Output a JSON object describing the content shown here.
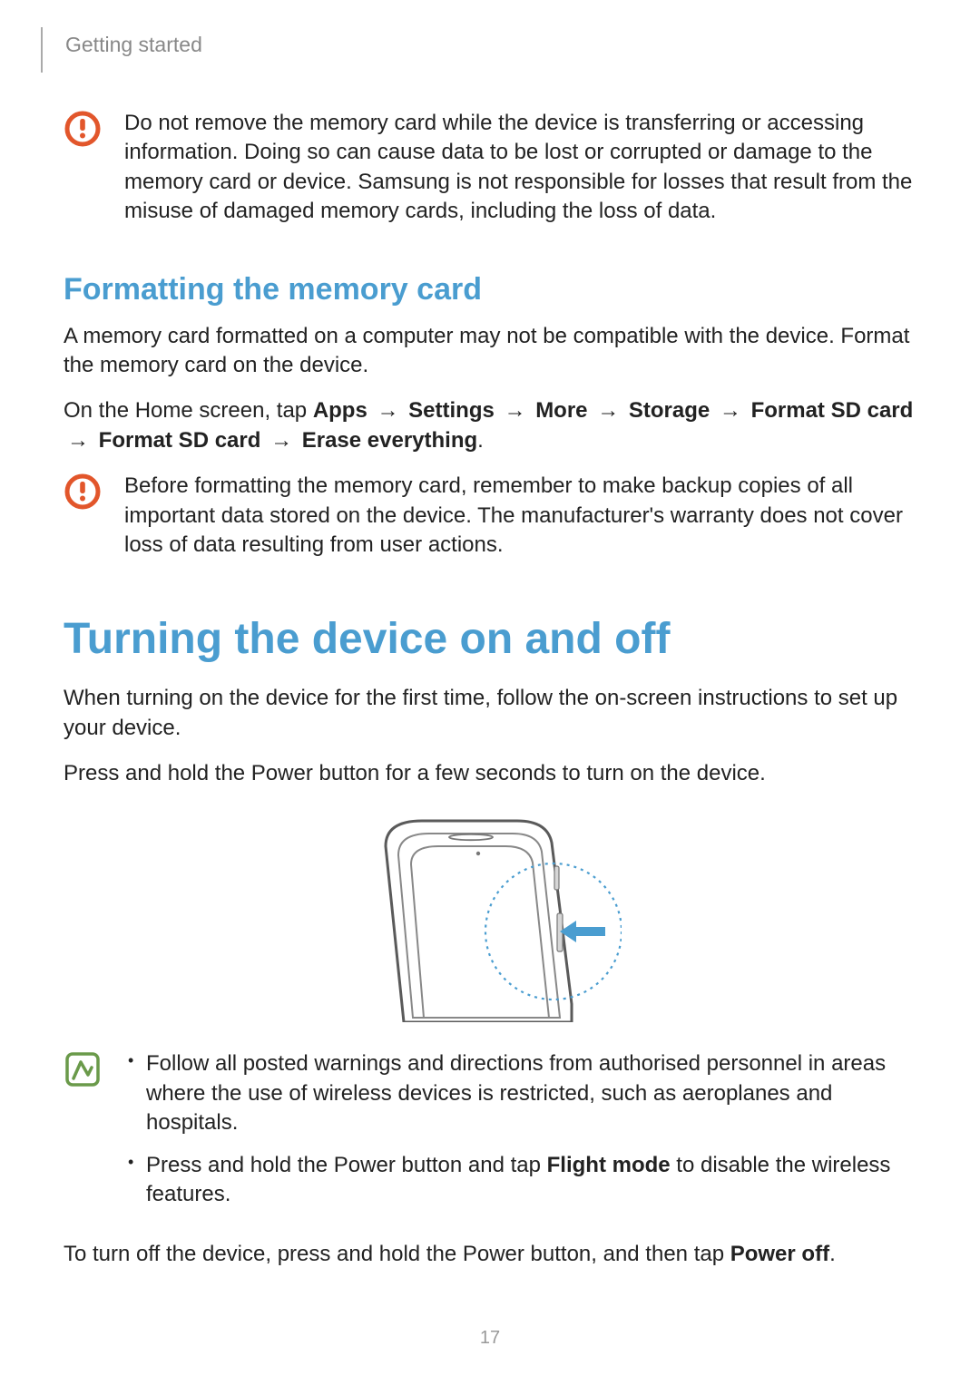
{
  "header": {
    "section": "Getting started"
  },
  "caution1": {
    "text": "Do not remove the memory card while the device is transferring or accessing information. Doing so can cause data to be lost or corrupted or damage to the memory card or device. Samsung is not responsible for losses that result from the misuse of damaged memory cards, including the loss of data."
  },
  "formatting": {
    "heading": "Formatting the memory card",
    "p1": "A memory card formatted on a computer may not be compatible with the device. Format the memory card on the device.",
    "p2_prefix": "On the Home screen, tap ",
    "steps": [
      "Apps",
      "Settings",
      "More",
      "Storage",
      "Format SD card",
      "Format SD card",
      "Erase everything"
    ],
    "arrow": "→"
  },
  "caution2": {
    "text": "Before formatting the memory card, remember to make backup copies of all important data stored on the device. The manufacturer's warranty does not cover loss of data resulting from user actions."
  },
  "turning": {
    "heading": "Turning the device on and off",
    "p1": "When turning on the device for the first time, follow the on-screen instructions to set up your device.",
    "p2": "Press and hold the Power button for a few seconds to turn on the device."
  },
  "note": {
    "bullet1": "Follow all posted warnings and directions from authorised personnel in areas where the use of wireless devices is restricted, such as aeroplanes and hospitals.",
    "bullet2_prefix": "Press and hold the Power button and tap ",
    "bullet2_bold": "Flight mode",
    "bullet2_suffix": " to disable the wireless features."
  },
  "turnoff": {
    "prefix": "To turn off the device, press and hold the Power button, and then tap ",
    "bold": "Power off",
    "suffix": "."
  },
  "pageNumber": "17"
}
